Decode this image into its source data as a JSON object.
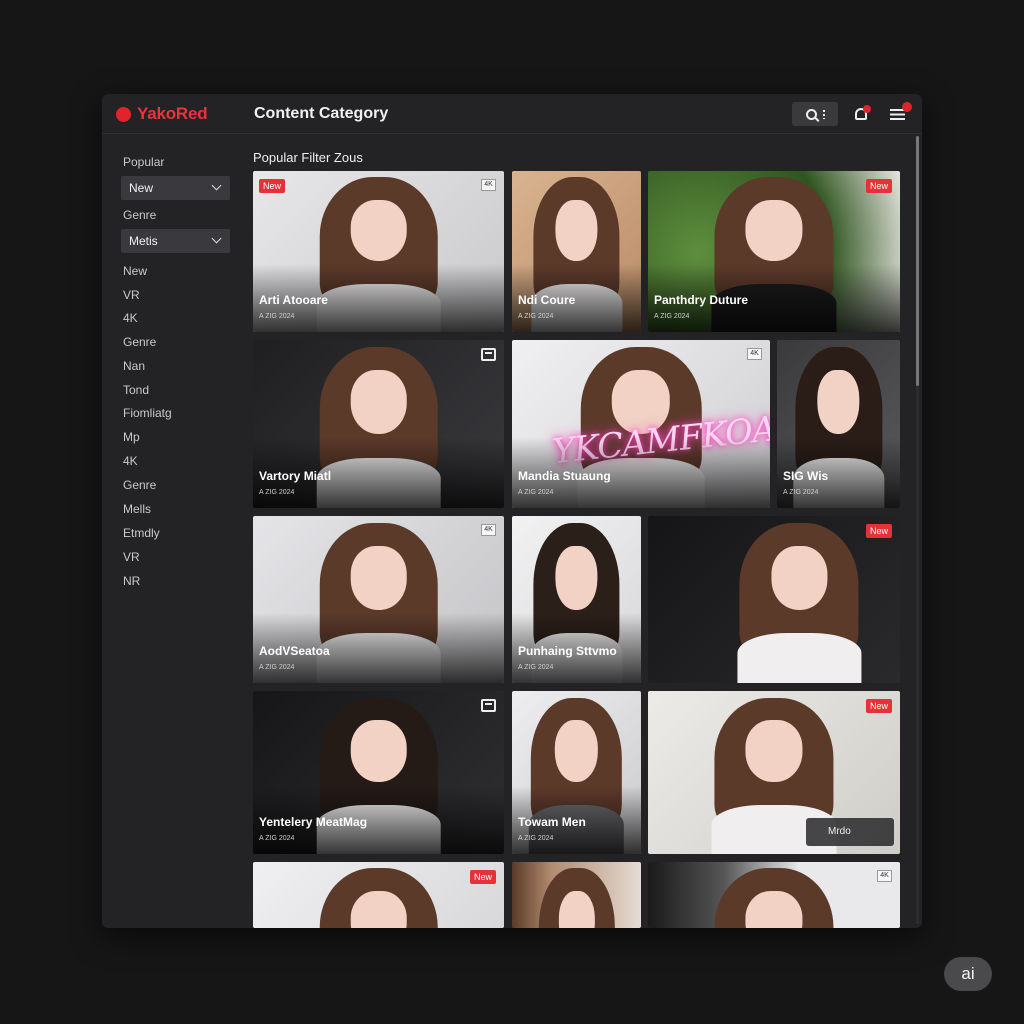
{
  "app": {
    "brand": "YakoRed",
    "page_title": "Content Category"
  },
  "sidebar": {
    "popular_label": "Popular",
    "select1": "New",
    "genre_label": "Genre",
    "select2": "Metis",
    "items": [
      "New",
      "VR",
      "4K",
      "Genre",
      "Nan",
      "Tond",
      "Fiomliatg",
      "Mp",
      "4K",
      "Genre",
      "Mells",
      "Etmdly",
      "VR",
      "NR"
    ]
  },
  "main": {
    "filter_title": "Popular Filter Zous",
    "badges": {
      "new": "New",
      "res": "4K"
    },
    "cards": [
      {
        "title": "Arti Atooare",
        "sub": "A ZIG 2024"
      },
      {
        "title": "Ndi Coure",
        "sub": "A ZIG 2024"
      },
      {
        "title": "Panthdry Duture",
        "sub": "A ZIG 2024"
      },
      {
        "title": "Vartory Miatl",
        "sub": "A ZIG 2024"
      },
      {
        "title": "Mandia Stuaung",
        "sub": "A ZIG 2024"
      },
      {
        "title": "SIG Wis",
        "sub": "A ZIG 2024"
      },
      {
        "title": "AodVSeatoa",
        "sub": "A ZIG 2024"
      },
      {
        "title": "Punhaing Sttvmo",
        "sub": "A ZIG 2024"
      },
      {
        "title": "",
        "sub": ""
      },
      {
        "title": "Yentelery MeatMag",
        "sub": "A ZIG 2024"
      },
      {
        "title": "Towam Men",
        "sub": "A ZIG 2024"
      },
      {
        "title": "",
        "sub": ""
      }
    ],
    "neon_text": "YKCAMFKOAJ",
    "watermark_tag": "Mrdo"
  },
  "footer": {
    "ai_badge": "ai"
  }
}
